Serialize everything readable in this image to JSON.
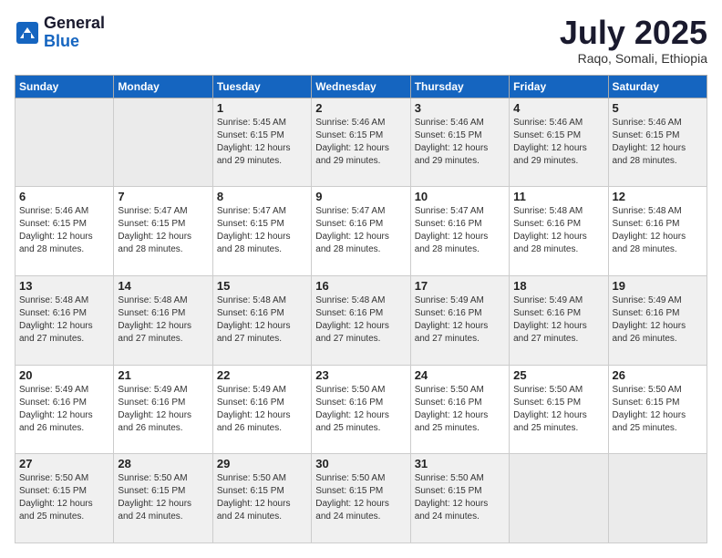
{
  "logo": {
    "general": "General",
    "blue": "Blue"
  },
  "title": "July 2025",
  "location": "Raqo, Somali, Ethiopia",
  "days_of_week": [
    "Sunday",
    "Monday",
    "Tuesday",
    "Wednesday",
    "Thursday",
    "Friday",
    "Saturday"
  ],
  "weeks": [
    [
      {
        "day": "",
        "empty": true
      },
      {
        "day": "",
        "empty": true
      },
      {
        "day": "1",
        "sunrise": "5:45 AM",
        "sunset": "6:15 PM",
        "daylight": "12 hours and 29 minutes."
      },
      {
        "day": "2",
        "sunrise": "5:46 AM",
        "sunset": "6:15 PM",
        "daylight": "12 hours and 29 minutes."
      },
      {
        "day": "3",
        "sunrise": "5:46 AM",
        "sunset": "6:15 PM",
        "daylight": "12 hours and 29 minutes."
      },
      {
        "day": "4",
        "sunrise": "5:46 AM",
        "sunset": "6:15 PM",
        "daylight": "12 hours and 29 minutes."
      },
      {
        "day": "5",
        "sunrise": "5:46 AM",
        "sunset": "6:15 PM",
        "daylight": "12 hours and 28 minutes."
      }
    ],
    [
      {
        "day": "6",
        "sunrise": "5:46 AM",
        "sunset": "6:15 PM",
        "daylight": "12 hours and 28 minutes."
      },
      {
        "day": "7",
        "sunrise": "5:47 AM",
        "sunset": "6:15 PM",
        "daylight": "12 hours and 28 minutes."
      },
      {
        "day": "8",
        "sunrise": "5:47 AM",
        "sunset": "6:15 PM",
        "daylight": "12 hours and 28 minutes."
      },
      {
        "day": "9",
        "sunrise": "5:47 AM",
        "sunset": "6:16 PM",
        "daylight": "12 hours and 28 minutes."
      },
      {
        "day": "10",
        "sunrise": "5:47 AM",
        "sunset": "6:16 PM",
        "daylight": "12 hours and 28 minutes."
      },
      {
        "day": "11",
        "sunrise": "5:48 AM",
        "sunset": "6:16 PM",
        "daylight": "12 hours and 28 minutes."
      },
      {
        "day": "12",
        "sunrise": "5:48 AM",
        "sunset": "6:16 PM",
        "daylight": "12 hours and 28 minutes."
      }
    ],
    [
      {
        "day": "13",
        "sunrise": "5:48 AM",
        "sunset": "6:16 PM",
        "daylight": "12 hours and 27 minutes."
      },
      {
        "day": "14",
        "sunrise": "5:48 AM",
        "sunset": "6:16 PM",
        "daylight": "12 hours and 27 minutes."
      },
      {
        "day": "15",
        "sunrise": "5:48 AM",
        "sunset": "6:16 PM",
        "daylight": "12 hours and 27 minutes."
      },
      {
        "day": "16",
        "sunrise": "5:48 AM",
        "sunset": "6:16 PM",
        "daylight": "12 hours and 27 minutes."
      },
      {
        "day": "17",
        "sunrise": "5:49 AM",
        "sunset": "6:16 PM",
        "daylight": "12 hours and 27 minutes."
      },
      {
        "day": "18",
        "sunrise": "5:49 AM",
        "sunset": "6:16 PM",
        "daylight": "12 hours and 27 minutes."
      },
      {
        "day": "19",
        "sunrise": "5:49 AM",
        "sunset": "6:16 PM",
        "daylight": "12 hours and 26 minutes."
      }
    ],
    [
      {
        "day": "20",
        "sunrise": "5:49 AM",
        "sunset": "6:16 PM",
        "daylight": "12 hours and 26 minutes."
      },
      {
        "day": "21",
        "sunrise": "5:49 AM",
        "sunset": "6:16 PM",
        "daylight": "12 hours and 26 minutes."
      },
      {
        "day": "22",
        "sunrise": "5:49 AM",
        "sunset": "6:16 PM",
        "daylight": "12 hours and 26 minutes."
      },
      {
        "day": "23",
        "sunrise": "5:50 AM",
        "sunset": "6:16 PM",
        "daylight": "12 hours and 25 minutes."
      },
      {
        "day": "24",
        "sunrise": "5:50 AM",
        "sunset": "6:16 PM",
        "daylight": "12 hours and 25 minutes."
      },
      {
        "day": "25",
        "sunrise": "5:50 AM",
        "sunset": "6:15 PM",
        "daylight": "12 hours and 25 minutes."
      },
      {
        "day": "26",
        "sunrise": "5:50 AM",
        "sunset": "6:15 PM",
        "daylight": "12 hours and 25 minutes."
      }
    ],
    [
      {
        "day": "27",
        "sunrise": "5:50 AM",
        "sunset": "6:15 PM",
        "daylight": "12 hours and 25 minutes."
      },
      {
        "day": "28",
        "sunrise": "5:50 AM",
        "sunset": "6:15 PM",
        "daylight": "12 hours and 24 minutes."
      },
      {
        "day": "29",
        "sunrise": "5:50 AM",
        "sunset": "6:15 PM",
        "daylight": "12 hours and 24 minutes."
      },
      {
        "day": "30",
        "sunrise": "5:50 AM",
        "sunset": "6:15 PM",
        "daylight": "12 hours and 24 minutes."
      },
      {
        "day": "31",
        "sunrise": "5:50 AM",
        "sunset": "6:15 PM",
        "daylight": "12 hours and 24 minutes."
      },
      {
        "day": "",
        "empty": true
      },
      {
        "day": "",
        "empty": true
      }
    ]
  ],
  "labels": {
    "sunrise": "Sunrise:",
    "sunset": "Sunset:",
    "daylight": "Daylight:"
  }
}
